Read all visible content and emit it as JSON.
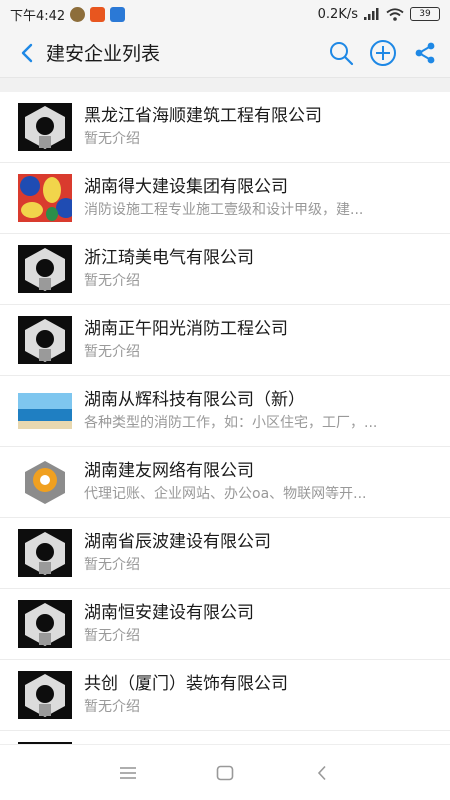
{
  "status_bar": {
    "time": "下午4:42",
    "network_speed": "0.2K/s",
    "battery": "39"
  },
  "app_bar": {
    "title": "建安企业列表",
    "colors": {
      "accent": "#1e88e5"
    }
  },
  "companies": [
    {
      "name": "黑龙江省海顺建筑工程有限公司",
      "desc": "暂无介绍",
      "logo": "default"
    },
    {
      "name": "湖南得大建设集团有限公司",
      "desc": "消防设施工程专业施工壹级和设计甲级，建...",
      "logo": "pattern"
    },
    {
      "name": "浙江琦美电气有限公司",
      "desc": "暂无介绍",
      "logo": "default"
    },
    {
      "name": "湖南正午阳光消防工程公司",
      "desc": "暂无介绍",
      "logo": "default"
    },
    {
      "name": "湖南从辉科技有限公司（新）",
      "desc": "各种类型的消防工作，如：小区住宅，工厂，...",
      "logo": "beach"
    },
    {
      "name": "湖南建友网络有限公司",
      "desc": "代理记账、企业网站、办公oa、物联网等开...",
      "logo": "gold"
    },
    {
      "name": "湖南省辰波建设有限公司",
      "desc": "暂无介绍",
      "logo": "default"
    },
    {
      "name": "湖南恒安建设有限公司",
      "desc": "暂无介绍",
      "logo": "default"
    },
    {
      "name": "共创（厦门）装饰有限公司",
      "desc": "暂无介绍",
      "logo": "default"
    },
    {
      "name": "",
      "desc": "",
      "logo": "default"
    }
  ]
}
